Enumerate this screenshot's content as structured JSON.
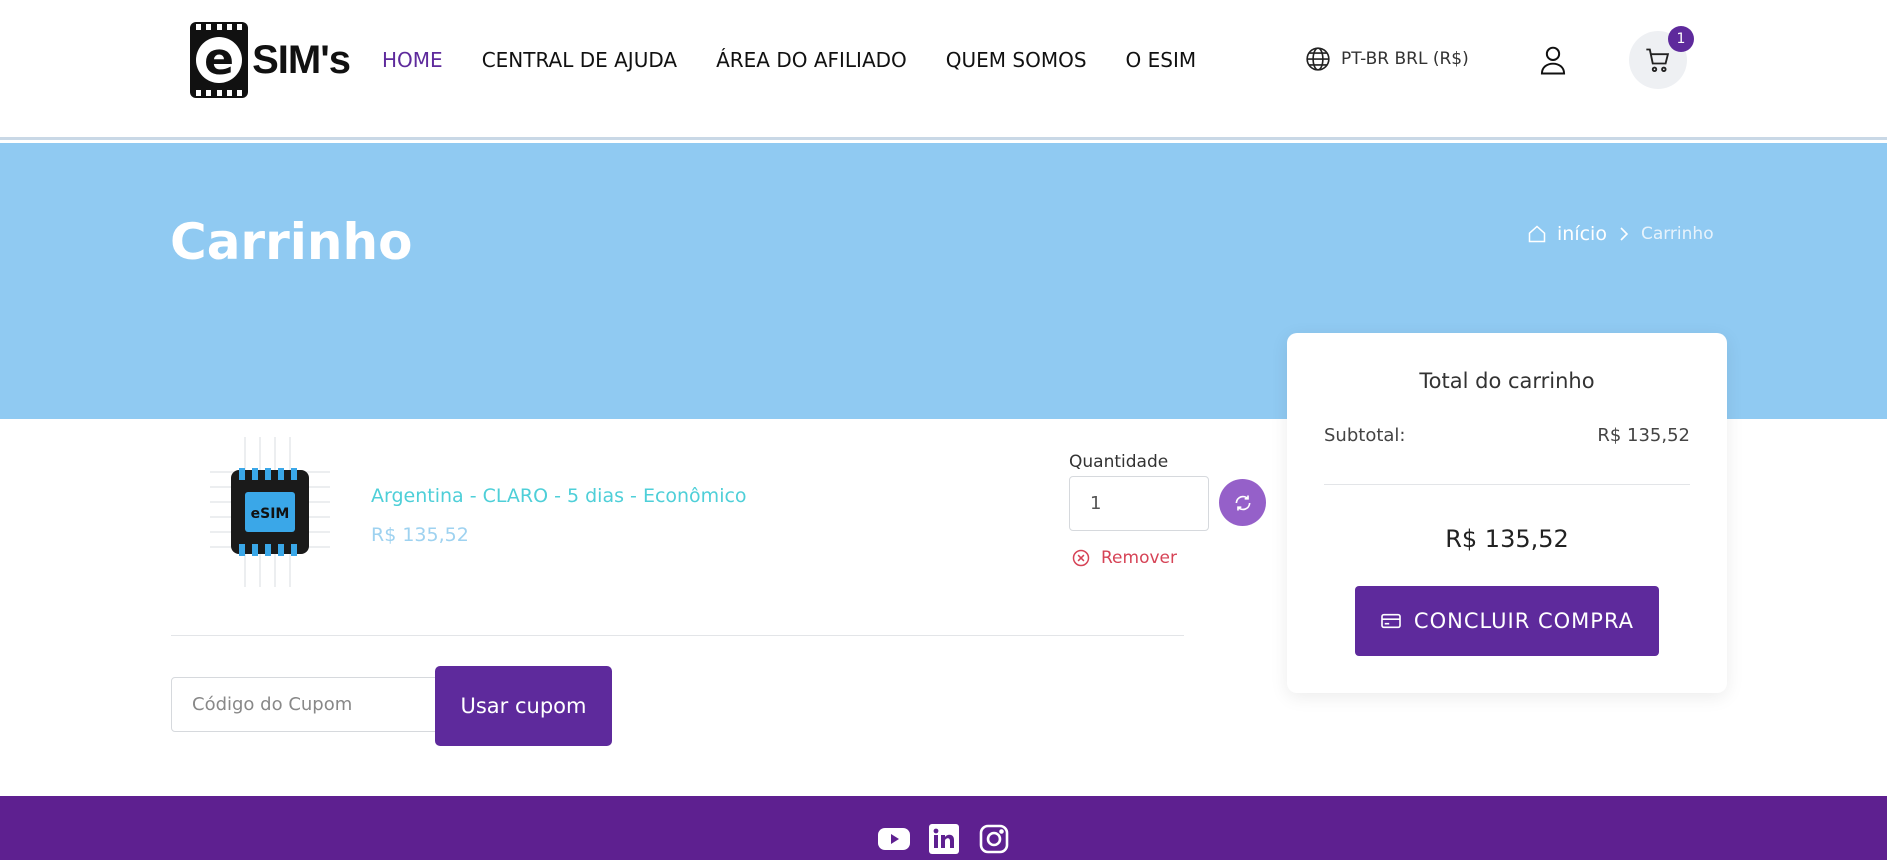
{
  "header": {
    "logo_text": "SIM's",
    "logo_letter": "e",
    "nav": [
      {
        "label": "HOME",
        "active": true
      },
      {
        "label": "CENTRAL DE AJUDA",
        "active": false
      },
      {
        "label": "ÁREA DO AFILIADO",
        "active": false
      },
      {
        "label": "QUEM SOMOS",
        "active": false
      },
      {
        "label": "O ESIM",
        "active": false
      }
    ],
    "language": "PT-BR BRL (R$)",
    "cart_count": "1"
  },
  "hero": {
    "title": "Carrinho",
    "breadcrumb": {
      "home": "início",
      "current": "Carrinho"
    }
  },
  "cart": {
    "item": {
      "name": "Argentina - CLARO - 5 dias - Econômico",
      "price": "R$ 135,52",
      "image_label": "eSIM"
    },
    "quantity_label": "Quantidade",
    "quantity_value": "1",
    "remove_label": "Remover",
    "coupon_placeholder": "Código do Cupom",
    "coupon_button": "Usar cupom"
  },
  "totals": {
    "title": "Total do carrinho",
    "subtotal_label": "Subtotal:",
    "subtotal_value": "R$ 135,52",
    "total_value": "R$ 135,52",
    "checkout_label": "CONCLUIR COMPRA"
  },
  "colors": {
    "brand_purple": "#5e2a9c",
    "hero_blue": "#90caf2",
    "link_cyan": "#4ecfd8",
    "remove_red": "#d64356"
  },
  "footer": {
    "socials": [
      "youtube-icon",
      "linkedin-icon",
      "instagram-icon"
    ]
  }
}
